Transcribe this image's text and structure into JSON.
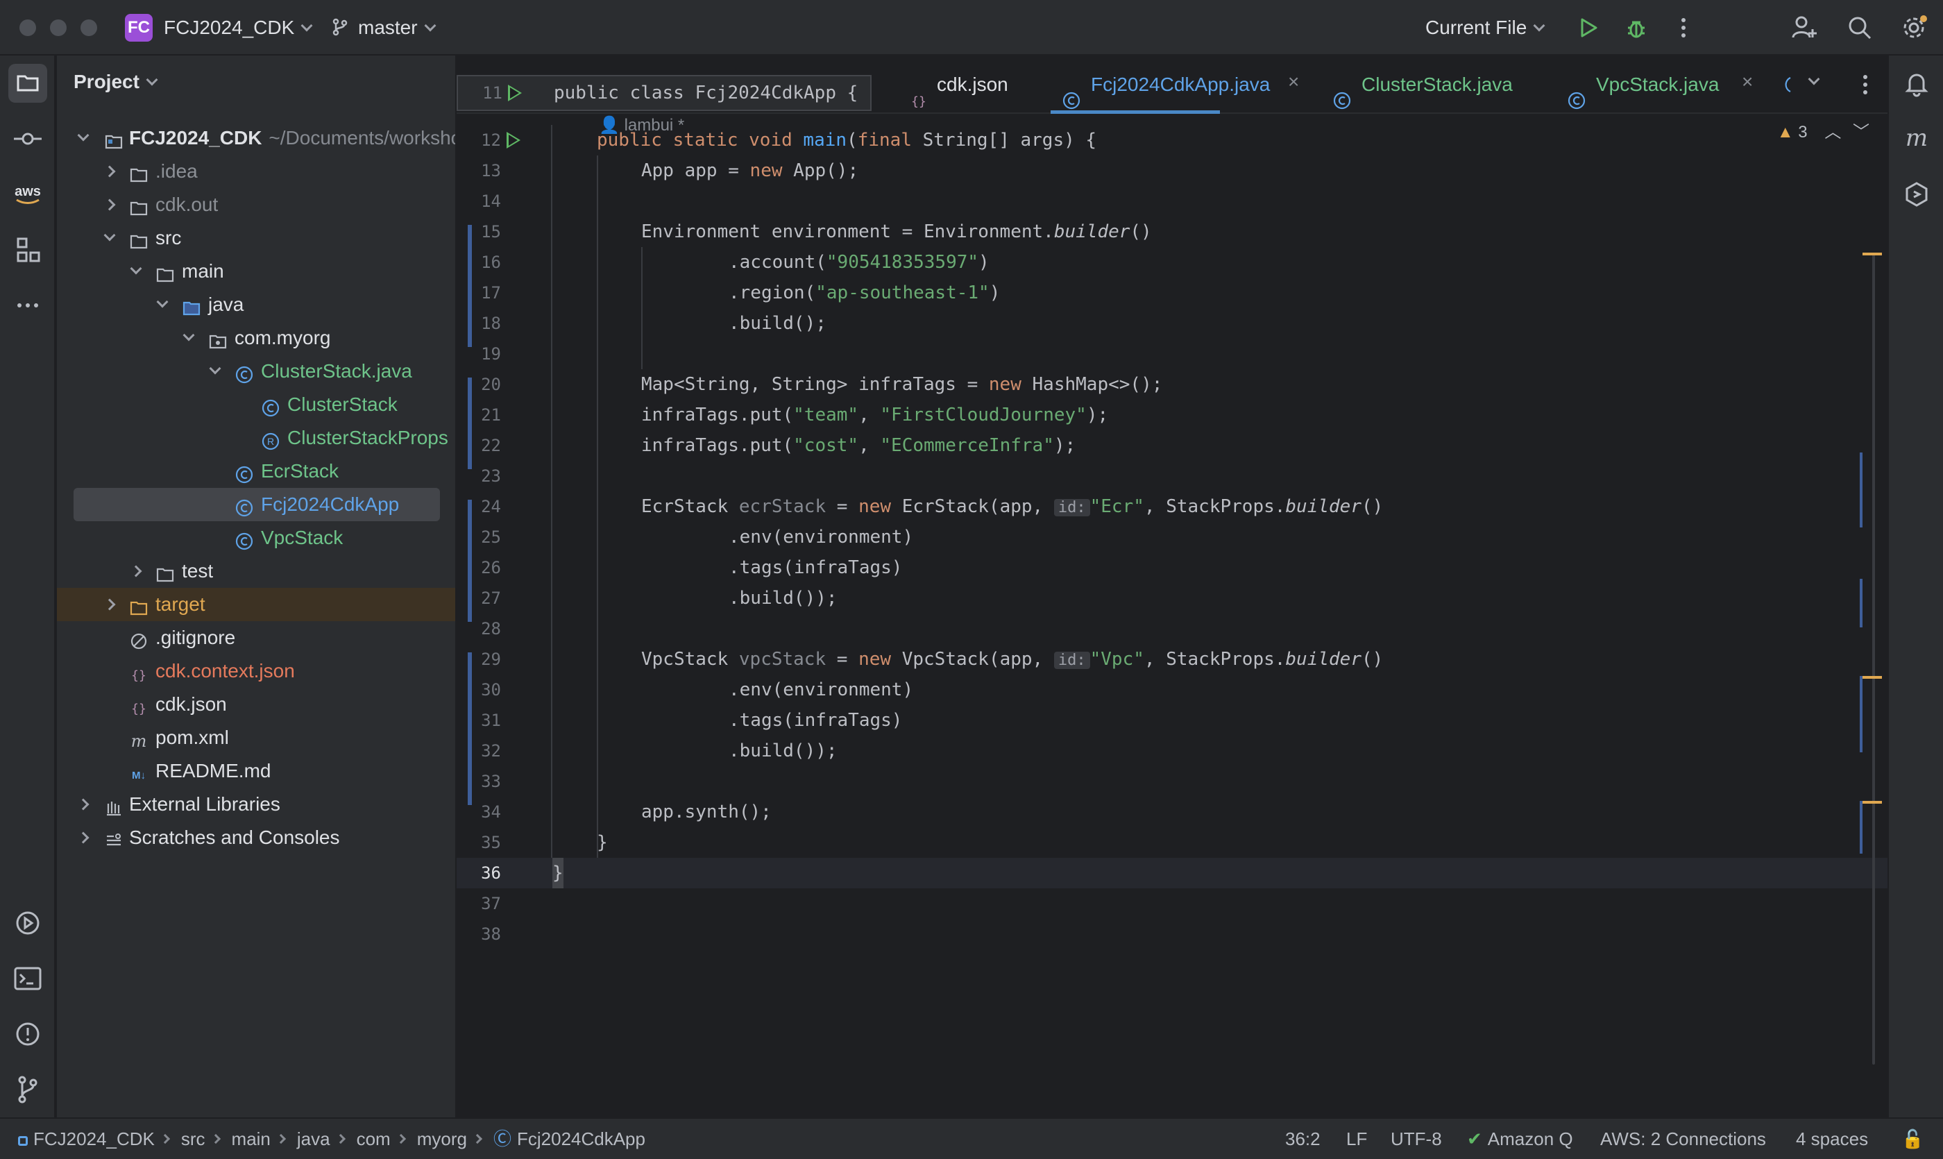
{
  "titlebar": {
    "project_badge": "FC",
    "project_name": "FCJ2024_CDK",
    "branch": "master",
    "run_config": "Current File"
  },
  "project_panel": {
    "title": "Project",
    "root_name": "FCJ2024_CDK",
    "root_path": "~/Documents/workshop",
    "items": [
      {
        "label": ".idea"
      },
      {
        "label": "cdk.out"
      },
      {
        "label": "src"
      },
      {
        "label": "main"
      },
      {
        "label": "java"
      },
      {
        "label": "com.myorg"
      },
      {
        "label": "ClusterStack.java"
      },
      {
        "label": "ClusterStack"
      },
      {
        "label": "ClusterStackProps"
      },
      {
        "label": "EcrStack"
      },
      {
        "label": "Fcj2024CdkApp"
      },
      {
        "label": "VpcStack"
      },
      {
        "label": "test"
      },
      {
        "label": "target"
      },
      {
        "label": ".gitignore"
      },
      {
        "label": "cdk.context.json"
      },
      {
        "label": "cdk.json"
      },
      {
        "label": "pom.xml"
      },
      {
        "label": "README.md"
      },
      {
        "label": "External Libraries"
      },
      {
        "label": "Scratches and Consoles"
      }
    ]
  },
  "tabs": [
    {
      "label": "cdk.json"
    },
    {
      "label": "Fcj2024CdkApp.java"
    },
    {
      "label": "ClusterStack.java"
    },
    {
      "label": "VpcStack.java"
    }
  ],
  "editor": {
    "sticky_line_number": "11",
    "sticky_line": "public class Fcj2024CdkApp {",
    "author": "lambui *",
    "warnings": "3",
    "lines": [
      {
        "n": "12"
      },
      {
        "n": "13"
      },
      {
        "n": "14"
      },
      {
        "n": "15"
      },
      {
        "n": "16"
      },
      {
        "n": "17"
      },
      {
        "n": "18"
      },
      {
        "n": "19"
      },
      {
        "n": "20"
      },
      {
        "n": "21"
      },
      {
        "n": "22"
      },
      {
        "n": "23"
      },
      {
        "n": "24"
      },
      {
        "n": "25"
      },
      {
        "n": "26"
      },
      {
        "n": "27"
      },
      {
        "n": "28"
      },
      {
        "n": "29"
      },
      {
        "n": "30"
      },
      {
        "n": "31"
      },
      {
        "n": "32"
      },
      {
        "n": "33"
      },
      {
        "n": "34"
      },
      {
        "n": "35"
      },
      {
        "n": "36"
      },
      {
        "n": "37"
      },
      {
        "n": "38"
      }
    ],
    "code": {
      "l12_kw": "public static void ",
      "l12_fn": "main",
      "l12_rest": "(",
      "l12_kw2": "final ",
      "l12_tail": "String[] args) {",
      "l13_a": "App app = ",
      "l13_kw": "new ",
      "l13_b": "App();",
      "l15_a": "Environment environment = Environment.",
      "l15_it": "builder",
      "l15_b": "()",
      "l16_a": ".account(",
      "l16_str": "\"905418353597\"",
      "l16_b": ")",
      "l17_a": ".region(",
      "l17_str": "\"ap-southeast-1\"",
      "l17_b": ")",
      "l18": ".build();",
      "l20_a": "Map<String, String> infraTags = ",
      "l20_kw": "new ",
      "l20_b": "HashMap<>();",
      "l21_a": "infraTags.put(",
      "l21_s1": "\"team\"",
      "l21_m": ", ",
      "l21_s2": "\"FirstCloudJourney\"",
      "l21_b": ");",
      "l22_a": "infraTags.put(",
      "l22_s1": "\"cost\"",
      "l22_m": ", ",
      "l22_s2": "\"ECommerceInfra\"",
      "l22_b": ");",
      "l24_a": "EcrStack ",
      "l24_var": "ecrStack",
      "l24_b": " = ",
      "l24_kw": "new ",
      "l24_c": "EcrStack(app, ",
      "l24_hint": "id:",
      "l24_str": "\"Ecr\"",
      "l24_d": ", StackProps.",
      "l24_it": "builder",
      "l24_e": "()",
      "l25": ".env(environment)",
      "l26": ".tags(infraTags)",
      "l27": ".build());",
      "l29_a": "VpcStack ",
      "l29_var": "vpcStack",
      "l29_b": " = ",
      "l29_kw": "new ",
      "l29_c": "VpcStack(app, ",
      "l29_hint": "id:",
      "l29_str": "\"Vpc\"",
      "l29_d": ", StackProps.",
      "l29_it": "builder",
      "l29_e": "()",
      "l30": ".env(environment)",
      "l31": ".tags(infraTags)",
      "l32": ".build());",
      "l34": "app.synth();",
      "l35": "}",
      "l36": "}"
    }
  },
  "statusbar": {
    "crumbs": [
      "FCJ2024_CDK",
      "src",
      "main",
      "java",
      "com",
      "myorg",
      "Fcj2024CdkApp"
    ],
    "position": "36:2",
    "line_sep": "LF",
    "encoding": "UTF-8",
    "amazon_q": "Amazon Q",
    "aws": "AWS: 2 Connections",
    "indent": "4 spaces"
  },
  "colors": {
    "accent": "#4a88c7",
    "java_class": "#5fa3e8",
    "folder_target": "#e0a851",
    "modified_file": "#e57a5c"
  }
}
